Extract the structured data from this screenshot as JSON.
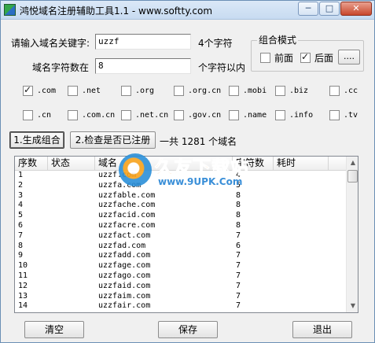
{
  "window": {
    "title": "鸿悦域名注册辅助工具1.1 - www.softty.com",
    "min_glyph": "─",
    "max_glyph": "□",
    "close_glyph": "✕"
  },
  "form": {
    "keyword_label": "请输入域名关键字:",
    "keyword_value": "uzzf",
    "keyword_suffix": "4个字符",
    "length_label": "域名字符数在",
    "length_value": "8",
    "length_suffix": "个字符以内"
  },
  "combo": {
    "title": "组合模式",
    "front_label": "前面",
    "front_checked": false,
    "back_label": "后面",
    "back_checked": true,
    "more_label": "...."
  },
  "tlds_row1": [
    {
      "label": ".com",
      "checked": true
    },
    {
      "label": ".net",
      "checked": false
    },
    {
      "label": ".org",
      "checked": false
    },
    {
      "label": ".org.cn",
      "checked": false
    },
    {
      "label": ".mobi",
      "checked": false
    },
    {
      "label": ".biz",
      "checked": false
    },
    {
      "label": ".cc",
      "checked": false
    }
  ],
  "tlds_row2": [
    {
      "label": ".cn",
      "checked": false
    },
    {
      "label": ".com.cn",
      "checked": false
    },
    {
      "label": ".net.cn",
      "checked": false
    },
    {
      "label": ".gov.cn",
      "checked": false
    },
    {
      "label": ".name",
      "checked": false
    },
    {
      "label": ".info",
      "checked": false
    },
    {
      "label": ".tv",
      "checked": false
    }
  ],
  "actions": {
    "generate_label": "1.生成组合",
    "check_label": "2.检查是否已注册",
    "total_text": "一共  1281  个域名"
  },
  "table": {
    "columns": [
      "序数",
      "状态",
      "域名",
      "字符数",
      "耗时"
    ],
    "rows": [
      [
        "1",
        "",
        "uzzf.com",
        "4",
        ""
      ],
      [
        "2",
        "",
        "uzzfa.com",
        "5",
        ""
      ],
      [
        "3",
        "",
        "uzzfable.com",
        "8",
        ""
      ],
      [
        "4",
        "",
        "uzzfache.com",
        "8",
        ""
      ],
      [
        "5",
        "",
        "uzzfacid.com",
        "8",
        ""
      ],
      [
        "6",
        "",
        "uzzfacre.com",
        "8",
        ""
      ],
      [
        "7",
        "",
        "uzzfact.com",
        "7",
        ""
      ],
      [
        "8",
        "",
        "uzzfad.com",
        "6",
        ""
      ],
      [
        "9",
        "",
        "uzzfadd.com",
        "7",
        ""
      ],
      [
        "10",
        "",
        "uzzfage.com",
        "7",
        ""
      ],
      [
        "11",
        "",
        "uzzfago.com",
        "7",
        ""
      ],
      [
        "12",
        "",
        "uzzfaid.com",
        "7",
        ""
      ],
      [
        "13",
        "",
        "uzzfaim.com",
        "7",
        ""
      ],
      [
        "14",
        "",
        "uzzfair.com",
        "7",
        ""
      ]
    ]
  },
  "watermark": {
    "cn": "久友下载站",
    "url": "www.9UPK.Com"
  },
  "bottom": {
    "clear_label": "清空",
    "save_label": "保存",
    "exit_label": "退出"
  },
  "colors": {
    "title_bar": "#c7dbf1",
    "close_button": "#c8472c",
    "watermark_orange": "#ff8a00",
    "watermark_blue": "#3a8fd8"
  }
}
